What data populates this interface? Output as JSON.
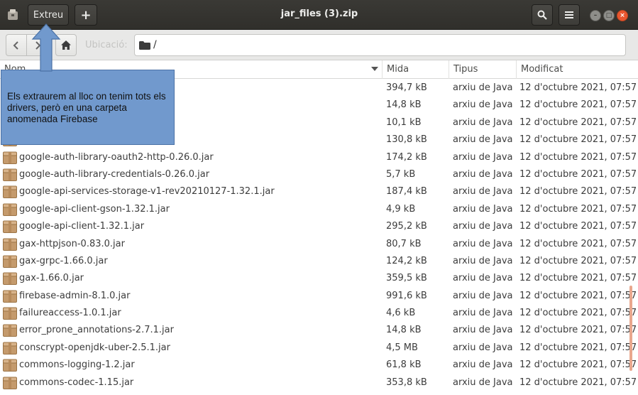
{
  "window": {
    "title": "jar_files (3).zip",
    "extract_label": "Extreu",
    "add_label": "+"
  },
  "location": {
    "path": "/",
    "hint": "Ubicació:"
  },
  "columns": {
    "name": "Nom",
    "size": "Mida",
    "type": "Tipus",
    "modified": "Modificat"
  },
  "annotation": {
    "text": "Els extraurem al lloc on tenim tots els drivers, però en una carpeta anomenada Firebase"
  },
  "files": [
    {
      "name": "",
      "size": "394,7 kB",
      "type": "arxiu de Java",
      "modified": "12 d'octubre 2021, 07:57"
    },
    {
      "name": "",
      "size": "14,8 kB",
      "type": "arxiu de Java",
      "modified": "12 d'octubre 2021, 07:57"
    },
    {
      "name": "",
      "size": "10,1 kB",
      "type": "arxiu de Java",
      "modified": "12 d'octubre 2021, 07:57"
    },
    {
      "name": "",
      "size": "130,8 kB",
      "type": "arxiu de Java",
      "modified": "12 d'octubre 2021, 07:57"
    },
    {
      "name": "google-auth-library-oauth2-http-0.26.0.jar",
      "size": "174,2 kB",
      "type": "arxiu de Java",
      "modified": "12 d'octubre 2021, 07:57"
    },
    {
      "name": "google-auth-library-credentials-0.26.0.jar",
      "size": "5,7 kB",
      "type": "arxiu de Java",
      "modified": "12 d'octubre 2021, 07:57"
    },
    {
      "name": "google-api-services-storage-v1-rev20210127-1.32.1.jar",
      "size": "187,4 kB",
      "type": "arxiu de Java",
      "modified": "12 d'octubre 2021, 07:57"
    },
    {
      "name": "google-api-client-gson-1.32.1.jar",
      "size": "4,9 kB",
      "type": "arxiu de Java",
      "modified": "12 d'octubre 2021, 07:57"
    },
    {
      "name": "google-api-client-1.32.1.jar",
      "size": "295,2 kB",
      "type": "arxiu de Java",
      "modified": "12 d'octubre 2021, 07:57"
    },
    {
      "name": "gax-httpjson-0.83.0.jar",
      "size": "80,7 kB",
      "type": "arxiu de Java",
      "modified": "12 d'octubre 2021, 07:57"
    },
    {
      "name": "gax-grpc-1.66.0.jar",
      "size": "124,2 kB",
      "type": "arxiu de Java",
      "modified": "12 d'octubre 2021, 07:57"
    },
    {
      "name": "gax-1.66.0.jar",
      "size": "359,5 kB",
      "type": "arxiu de Java",
      "modified": "12 d'octubre 2021, 07:57"
    },
    {
      "name": "firebase-admin-8.1.0.jar",
      "size": "991,6 kB",
      "type": "arxiu de Java",
      "modified": "12 d'octubre 2021, 07:57"
    },
    {
      "name": "failureaccess-1.0.1.jar",
      "size": "4,6 kB",
      "type": "arxiu de Java",
      "modified": "12 d'octubre 2021, 07:57"
    },
    {
      "name": "error_prone_annotations-2.7.1.jar",
      "size": "14,8 kB",
      "type": "arxiu de Java",
      "modified": "12 d'octubre 2021, 07:57"
    },
    {
      "name": "conscrypt-openjdk-uber-2.5.1.jar",
      "size": "4,5 MB",
      "type": "arxiu de Java",
      "modified": "12 d'octubre 2021, 07:57"
    },
    {
      "name": "commons-logging-1.2.jar",
      "size": "61,8 kB",
      "type": "arxiu de Java",
      "modified": "12 d'octubre 2021, 07:57"
    },
    {
      "name": "commons-codec-1.15.jar",
      "size": "353,8 kB",
      "type": "arxiu de Java",
      "modified": "12 d'octubre 2021, 07:57"
    }
  ],
  "icons": {
    "app": "archive-manager-icon",
    "search": "search-icon",
    "menu": "hamburger-menu-icon",
    "back": "chevron-left-icon",
    "forward": "chevron-right-icon",
    "home": "home-icon",
    "path": "folder-icon",
    "file": "jar-archive-icon"
  },
  "colors": {
    "titlebar": "#3a3935",
    "annotation_fill": "#7199cd",
    "close_button": "#e9562f",
    "scrollbar": "#e9a78d"
  }
}
